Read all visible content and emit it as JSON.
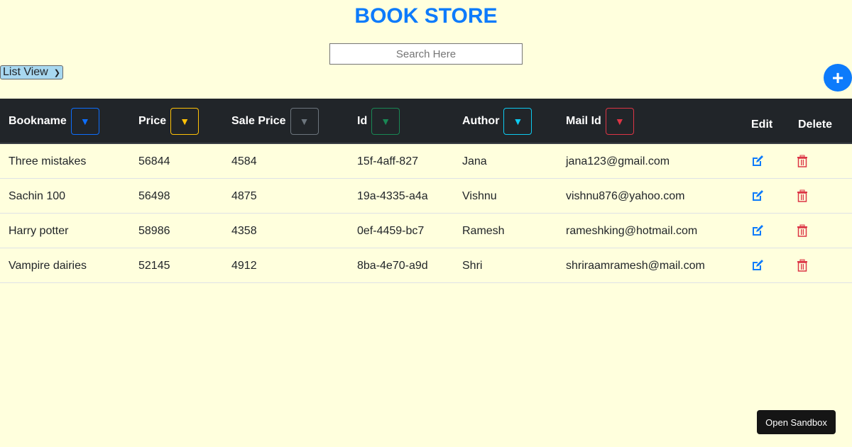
{
  "title": "BOOK STORE",
  "search": {
    "placeholder": "Search Here",
    "value": ""
  },
  "view_select": {
    "selected": "List View"
  },
  "add_button_label": "+",
  "colors": {
    "accent": "#0d7bfb",
    "header_bg": "#212529",
    "page_bg": "#ffffdd",
    "delete": "#dc3545"
  },
  "columns": [
    {
      "label": "Bookname",
      "sort_color": "#0d6efd"
    },
    {
      "label": "Price",
      "sort_color": "#ffc107"
    },
    {
      "label": "Sale Price",
      "sort_color": "#6c757d"
    },
    {
      "label": "Id",
      "sort_color": "#198754"
    },
    {
      "label": "Author",
      "sort_color": "#0dcaf0"
    },
    {
      "label": "Mail Id",
      "sort_color": "#dc3545"
    },
    {
      "label": "Edit"
    },
    {
      "label": "Delete"
    }
  ],
  "rows": [
    {
      "bookname": "Three mistakes",
      "price": "56844",
      "sale_price": "4584",
      "id": "15f-4aff-827",
      "author": "Jana",
      "mail": "jana123@gmail.com"
    },
    {
      "bookname": "Sachin 100",
      "price": "56498",
      "sale_price": "4875",
      "id": "19a-4335-a4a",
      "author": "Vishnu",
      "mail": "vishnu876@yahoo.com"
    },
    {
      "bookname": "Harry potter",
      "price": "58986",
      "sale_price": "4358",
      "id": "0ef-4459-bc7",
      "author": "Ramesh",
      "mail": "rameshking@hotmail.com"
    },
    {
      "bookname": "Vampire dairies",
      "price": "52145",
      "sale_price": "4912",
      "id": "8ba-4e70-a9d",
      "author": "Shri",
      "mail": "shriraamramesh@mail.com"
    }
  ],
  "sandbox_label": "Open Sandbox"
}
